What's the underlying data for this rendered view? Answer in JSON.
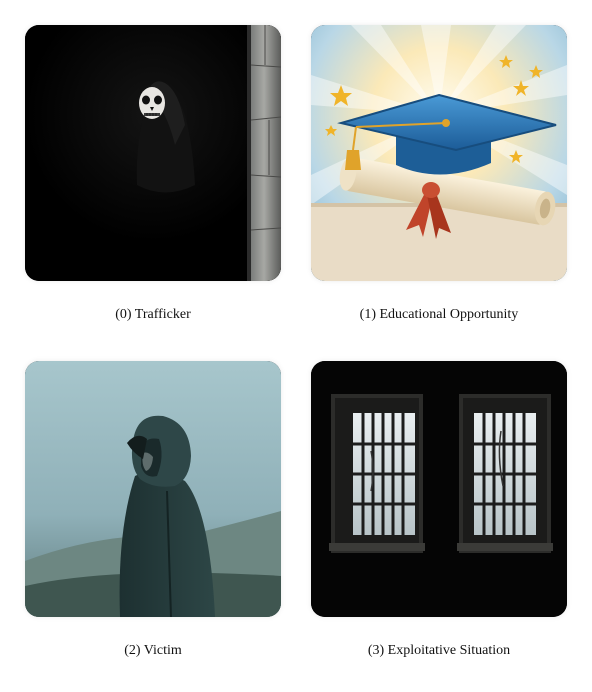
{
  "items": [
    {
      "label": "(0) Trafficker",
      "image": "masked-figure-in-dark-doorway"
    },
    {
      "label": "(1) Educational Opportunity",
      "image": "graduation-cap-and-diploma"
    },
    {
      "label": "(2) Victim",
      "image": "hooded-person-in-fog"
    },
    {
      "label": "(3) Exploitative Situation",
      "image": "barred-windows-dark-room"
    }
  ]
}
